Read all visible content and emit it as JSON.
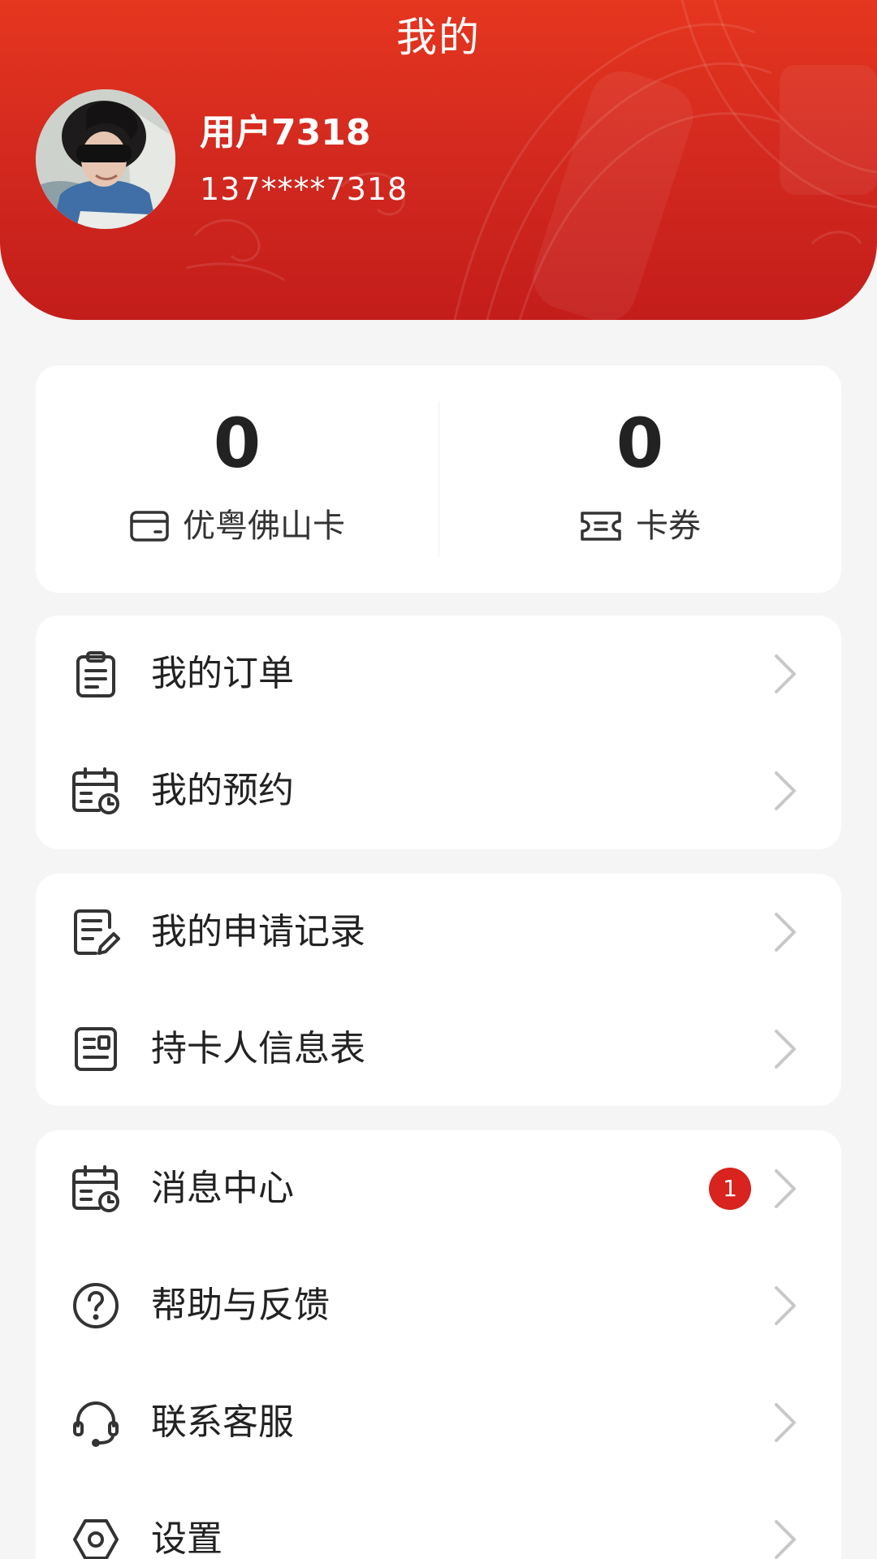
{
  "header": {
    "title": "我的",
    "background_color": "#d42a1f"
  },
  "user": {
    "name": "用户7318",
    "phone": "137****7318"
  },
  "stats": [
    {
      "value": "0",
      "label": "优粤佛山卡",
      "icon": "card-icon"
    },
    {
      "value": "0",
      "label": "卡券",
      "icon": "ticket-icon"
    }
  ],
  "menu_groups": [
    [
      {
        "label": "我的订单",
        "icon": "clipboard-icon"
      },
      {
        "label": "我的预约",
        "icon": "calendar-clock-icon"
      }
    ],
    [
      {
        "label": "我的申请记录",
        "icon": "edit-document-icon"
      },
      {
        "label": "持卡人信息表",
        "icon": "id-form-icon"
      }
    ],
    [
      {
        "label": "消息中心",
        "icon": "calendar-clock-icon",
        "badge": "1"
      },
      {
        "label": "帮助与反馈",
        "icon": "help-circle-icon"
      },
      {
        "label": "联系客服",
        "icon": "headset-icon"
      },
      {
        "label": "设置",
        "icon": "settings-hexagon-icon"
      }
    ]
  ],
  "colors": {
    "accent": "#d9231e",
    "page_background": "#f5f5f5",
    "card_background": "#ffffff"
  }
}
